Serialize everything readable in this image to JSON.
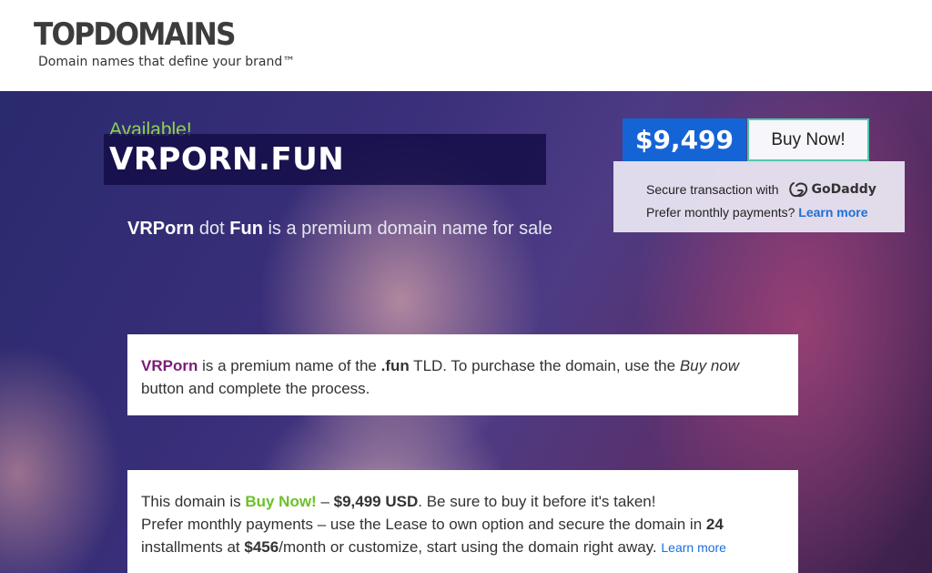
{
  "header": {
    "logo": "TOPDOMAINS",
    "tagline": "Domain names that define your brand™"
  },
  "hero": {
    "available": "Available!",
    "domain": "VRPORN.FUN",
    "subtitle": {
      "name": "VRPorn",
      "dot": " dot ",
      "tld": "Fun",
      "rest": " is a premium domain name for sale"
    }
  },
  "purchase": {
    "price": "$9,499",
    "buy_label": "Buy Now!",
    "secure_text": "Secure transaction with",
    "provider": "GoDaddy",
    "monthly_text": "Prefer monthly payments?",
    "learn_more": "Learn more"
  },
  "card1": {
    "name": "VRPorn",
    "t1": " is a premium name of the ",
    "tld": ".fun",
    "t2": " TLD. To purchase the domain, use the ",
    "buy_now": "Buy now",
    "t3": " button and complete the process."
  },
  "card2": {
    "t1": "This domain is ",
    "buy_now": "Buy Now!",
    "t2": " – ",
    "price": "$9,499 USD",
    "t3": ". Be sure to buy it before it's taken!",
    "t4": "Prefer monthly payments – use the Lease to own option and secure the domain in ",
    "installments": "24",
    "t5": " installments at ",
    "monthly": "$456",
    "t6": "/month or customize, start using the domain right away. ",
    "learn_more": "Learn more"
  },
  "colors": {
    "accent_green": "#8fd14f",
    "price_blue": "#1564d6",
    "brand_purple": "#7b1a79",
    "link_blue": "#1a6fd8"
  }
}
